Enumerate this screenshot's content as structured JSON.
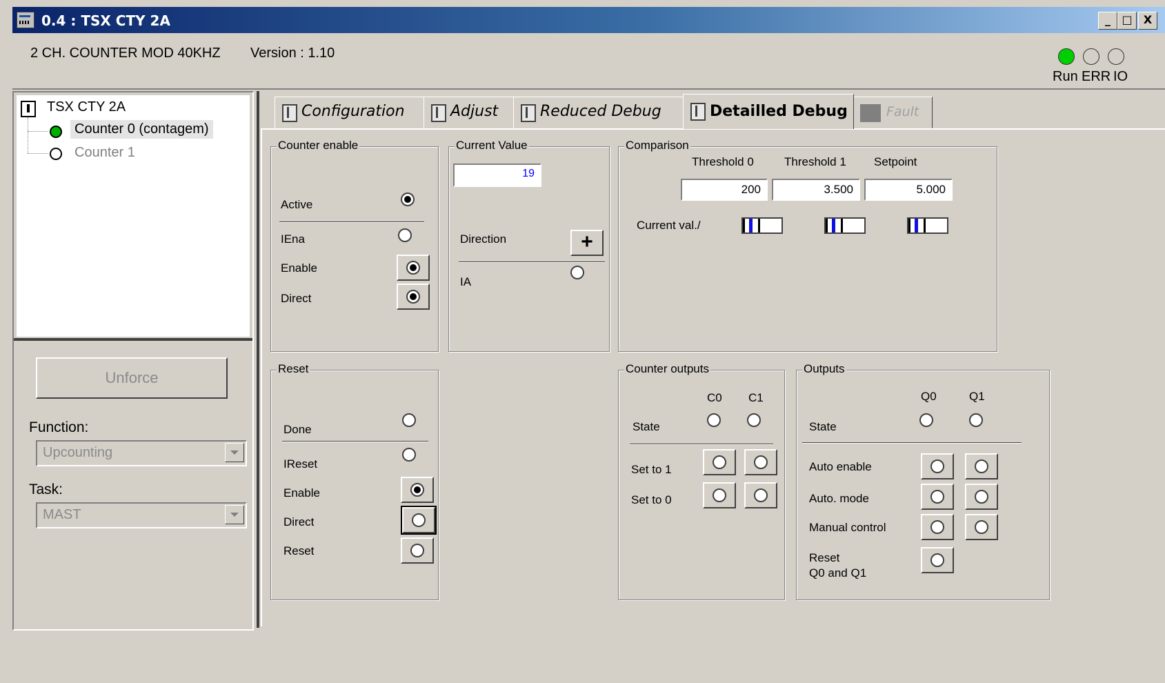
{
  "window": {
    "title": "0.4 : TSX CTY 2A",
    "min": "_",
    "max": "□",
    "close": "X"
  },
  "module": {
    "name": "2 CH. COUNTER MOD 40KHZ",
    "version": "Version : 1.10"
  },
  "leds": [
    {
      "label": "Run",
      "color": "#00d000"
    },
    {
      "label": "ERR",
      "color": "#d4d0c8"
    },
    {
      "label": "IO",
      "color": "#d4d0c8"
    }
  ],
  "tree": {
    "root": "TSX CTY 2A",
    "items": [
      {
        "label": "Counter 0 (contagem)",
        "color": "#00b000"
      },
      {
        "label": "Counter 1",
        "color": "#ffffff"
      }
    ]
  },
  "left": {
    "unforce": "Unforce",
    "function_label": "Function:",
    "function_value": "Upcounting",
    "task_label": "Task:",
    "task_value": "MAST"
  },
  "tabs": [
    "Configuration",
    "Adjust",
    "Reduced Debug",
    "Detailled Debug",
    "Fault"
  ],
  "counter_enable": {
    "title": "Counter enable",
    "active": "Active",
    "iena": "IEna",
    "enable": "Enable",
    "direct": "Direct"
  },
  "current_value": {
    "title": "Current Value",
    "value": "19",
    "direction": "Direction",
    "direction_sign": "+",
    "ia": "IA"
  },
  "comparison": {
    "title": "Comparison",
    "headers": [
      "Threshold 0",
      "Threshold 1",
      "Setpoint"
    ],
    "values": [
      "200",
      "3.500",
      "5.000"
    ],
    "current_label": "Current val./"
  },
  "reset": {
    "title": "Reset",
    "done": "Done",
    "ireset": "IReset",
    "enable": "Enable",
    "direct": "Direct",
    "reset": "Reset"
  },
  "counter_outputs": {
    "title": "Counter outputs",
    "c0": "C0",
    "c1": "C1",
    "state": "State",
    "set1": "Set to 1",
    "set0": "Set to 0"
  },
  "outputs": {
    "title": "Outputs",
    "q0": "Q0",
    "q1": "Q1",
    "state": "State",
    "auto_enable": "Auto enable",
    "auto_mode": "Auto. mode",
    "manual": "Manual control",
    "reset1": "Reset",
    "reset2": "Q0 and Q1"
  }
}
